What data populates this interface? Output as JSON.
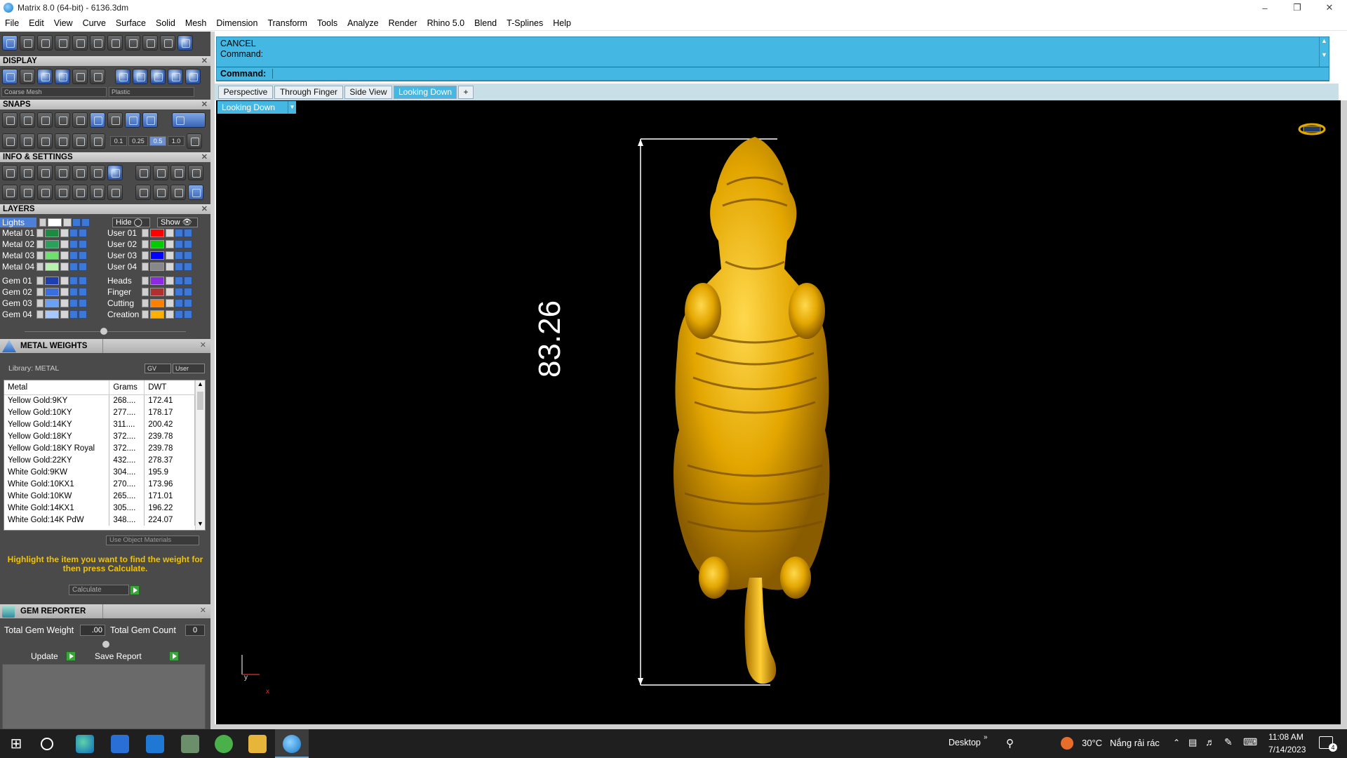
{
  "window": {
    "title": "Matrix 8.0 (64-bit) - 6136.3dm"
  },
  "menu": [
    "File",
    "Edit",
    "View",
    "Curve",
    "Surface",
    "Solid",
    "Mesh",
    "Dimension",
    "Transform",
    "Tools",
    "Analyze",
    "Render",
    "Rhino 5.0",
    "Blend",
    "T-Splines",
    "Help"
  ],
  "panels": {
    "display": "DISPLAY",
    "snaps": "SNAPS",
    "info": "INFO & SETTINGS",
    "layers": "LAYERS",
    "display_mesh": "Coarse Mesh",
    "display_material": "Plastic",
    "snap_values": [
      "0.1",
      "0.25",
      "0.5",
      "1.0"
    ]
  },
  "layers": {
    "lights": "Lights",
    "hide": "Hide",
    "show": "Show",
    "left": [
      {
        "name": "Metal 01",
        "color": "#1c8a3f"
      },
      {
        "name": "Metal 02",
        "color": "#2aa05a"
      },
      {
        "name": "Metal 03",
        "color": "#6fe06f"
      },
      {
        "name": "Metal 04",
        "color": "#b8f0b0"
      },
      {
        "name": "Gem 01",
        "color": "#1f3fb0"
      },
      {
        "name": "Gem 02",
        "color": "#3a6fe0"
      },
      {
        "name": "Gem 03",
        "color": "#6aa0f5"
      },
      {
        "name": "Gem 04",
        "color": "#a9c8ff"
      }
    ],
    "right": [
      {
        "name": "User 01",
        "color": "#ff0000"
      },
      {
        "name": "User 02",
        "color": "#00cc00"
      },
      {
        "name": "User 03",
        "color": "#0000ff"
      },
      {
        "name": "User 04",
        "color": "#888888"
      },
      {
        "name": "Heads",
        "color": "#8a2be2"
      },
      {
        "name": "Finger",
        "color": "#b03030"
      },
      {
        "name": "Cutting",
        "color": "#ff7f00"
      },
      {
        "name": "Creation",
        "color": "#ffb000"
      }
    ]
  },
  "metal_weights": {
    "title": "METAL WEIGHTS",
    "library": "Library: METAL",
    "gv": "GV",
    "user": "User",
    "headers": [
      "Metal",
      "Grams",
      "DWT"
    ],
    "rows": [
      [
        "Yellow Gold:9KY",
        "268....",
        "172.41"
      ],
      [
        "Yellow Gold:10KY",
        "277....",
        "178.17"
      ],
      [
        "Yellow Gold:14KY",
        "311....",
        "200.42"
      ],
      [
        "Yellow Gold:18KY",
        "372....",
        "239.78"
      ],
      [
        "Yellow Gold:18KY Royal",
        "372....",
        "239.78"
      ],
      [
        "Yellow Gold:22KY",
        "432....",
        "278.37"
      ],
      [
        "White Gold:9KW",
        "304....",
        "195.9"
      ],
      [
        "White Gold:10KX1",
        "270....",
        "173.96"
      ],
      [
        "White Gold:10KW",
        "265....",
        "171.01"
      ],
      [
        "White Gold:14KX1",
        "305....",
        "196.22"
      ],
      [
        "White Gold:14K PdW",
        "348....",
        "224.07"
      ]
    ],
    "use_object_materials": "Use Object Materials",
    "hint": "Highlight the item you want to find the weight for then press Calculate.",
    "calculate": "Calculate"
  },
  "gem_reporter": {
    "title": "GEM REPORTER",
    "total_weight_label": "Total Gem Weight",
    "total_weight": ".00",
    "total_count_label": "Total Gem Count",
    "total_count": "0",
    "update": "Update",
    "save_report": "Save Report"
  },
  "command": {
    "history_1": "CANCEL",
    "history_2": "Command:",
    "prompt": "Command:"
  },
  "viewport": {
    "tabs": [
      "Perspective",
      "Through Finger",
      "Side View",
      "Looking Down"
    ],
    "active_tab": "Looking Down",
    "add_tab": "+",
    "current_view": "Looking Down",
    "dimension": "83.26",
    "axis_y": "y",
    "axis_x": "x"
  },
  "taskbar": {
    "desktop": "Desktop",
    "weather_temp": "30°C",
    "weather_text": "Nắng rải rác",
    "time": "11:08 AM",
    "date": "7/14/2023",
    "notifications": "4"
  },
  "colors": {
    "accent": "#44b8e3",
    "panel": "#4a4a4a",
    "gold": "#e0a800"
  }
}
